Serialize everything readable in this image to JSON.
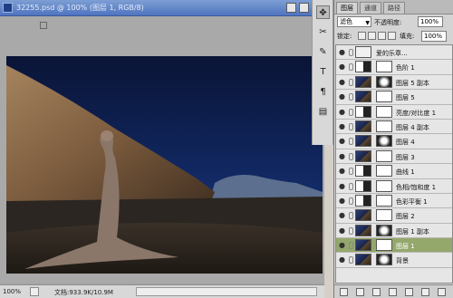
{
  "document": {
    "title": "32255.psd @ 100% (图层 1, RGB/8)",
    "zoom": "100%",
    "doc_size": "文档:933.9K/10.9M"
  },
  "layers_panel": {
    "tabs": [
      "图层",
      "通道",
      "路径"
    ],
    "blend_mode": "滤色",
    "opacity_label": "不透明度:",
    "opacity_value": "100%",
    "lock_label": "锁定:",
    "fill_label": "填充:",
    "fill_value": "100%",
    "layers": [
      {
        "name": "爱的乐章...",
        "kind": "text",
        "selected": false
      },
      {
        "name": "色阶 1",
        "kind": "adjust",
        "selected": false
      },
      {
        "name": "图层 5 副本",
        "kind": "image",
        "selected": false
      },
      {
        "name": "图层 5",
        "kind": "image",
        "selected": false
      },
      {
        "name": "亮度/对比度 1",
        "kind": "adjust",
        "selected": false
      },
      {
        "name": "图层 4 副本",
        "kind": "image",
        "selected": false
      },
      {
        "name": "图层 4",
        "kind": "image",
        "selected": false
      },
      {
        "name": "图层 3",
        "kind": "image",
        "selected": false
      },
      {
        "name": "曲线 1",
        "kind": "adjust",
        "selected": false
      },
      {
        "name": "色相/饱和度 1",
        "kind": "adjust",
        "selected": false
      },
      {
        "name": "色彩平衡 1",
        "kind": "adjust",
        "selected": false
      },
      {
        "name": "图层 2",
        "kind": "image",
        "selected": false
      },
      {
        "name": "图层 1 副本",
        "kind": "image",
        "selected": false
      },
      {
        "name": "图层 1",
        "kind": "image",
        "selected": true
      },
      {
        "name": "背景",
        "kind": "image",
        "selected": false
      }
    ]
  },
  "tools": [
    "move-tool-icon",
    "scissors-icon",
    "brush-icon",
    "type-icon",
    "path-icon",
    "note-icon"
  ],
  "colors": {
    "selected_layer": "#94a86c",
    "title_bar": "#4f74bf",
    "sky": "#0c1a44"
  }
}
